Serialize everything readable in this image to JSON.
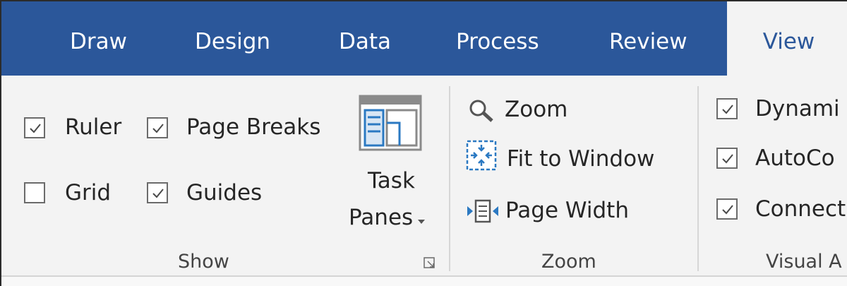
{
  "tabs": [
    {
      "id": "draw",
      "label": "Draw",
      "active": false
    },
    {
      "id": "design",
      "label": "Design",
      "active": false
    },
    {
      "id": "data",
      "label": "Data",
      "active": false
    },
    {
      "id": "process",
      "label": "Process",
      "active": false
    },
    {
      "id": "review",
      "label": "Review",
      "active": false
    },
    {
      "id": "view",
      "label": "View",
      "active": true
    }
  ],
  "show": {
    "group_label": "Show",
    "checkboxes": [
      {
        "label": "Ruler",
        "checked": true
      },
      {
        "label": "Page Breaks",
        "checked": true
      },
      {
        "label": "Grid",
        "checked": false
      },
      {
        "label": "Guides",
        "checked": true
      }
    ],
    "task_panes": {
      "line1": "Task",
      "line2": "Panes",
      "dropdown_icon": "dropdown-arrow-icon"
    },
    "launcher_icon": "dialog-launcher-icon"
  },
  "zoom": {
    "group_label": "Zoom",
    "buttons": [
      {
        "label": "Zoom",
        "icon": "magnifier-icon"
      },
      {
        "label": "Fit to Window",
        "icon": "fit-to-window-icon"
      },
      {
        "label": "Page Width",
        "icon": "page-width-icon"
      }
    ]
  },
  "visual_aids": {
    "group_label": "Visual A",
    "checkboxes": [
      {
        "label": "Dynami",
        "checked": true
      },
      {
        "label": "AutoCo",
        "checked": true
      },
      {
        "label": "Connect",
        "checked": true
      }
    ]
  },
  "colors": {
    "tab_bar": "#2b579a",
    "ribbon": "#f3f3f3",
    "accent": "#2b579a"
  }
}
